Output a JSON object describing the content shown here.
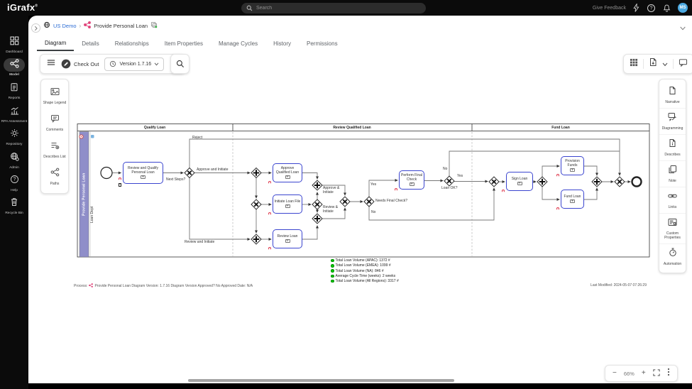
{
  "topbar": {
    "logo": "iGrafx",
    "logo_mark": "®",
    "search_placeholder": "Search",
    "give_feedback": "Give Feedback",
    "avatar": "MS"
  },
  "sidebar": {
    "items": [
      {
        "label": "Dashboard"
      },
      {
        "label": "Model"
      },
      {
        "label": "Reports"
      },
      {
        "label": "RPA Assessment"
      },
      {
        "label": "Repository"
      },
      {
        "label": "Admin"
      },
      {
        "label": "Help"
      },
      {
        "label": "Recycle Bin"
      }
    ]
  },
  "breadcrumb": {
    "root": "US Demo",
    "sep": "›",
    "current": "Provide Personal Loan"
  },
  "tabs": [
    {
      "label": "Diagram"
    },
    {
      "label": "Details"
    },
    {
      "label": "Relationships"
    },
    {
      "label": "Item Properties"
    },
    {
      "label": "Manage Cycles"
    },
    {
      "label": "History"
    },
    {
      "label": "Permissions"
    }
  ],
  "toolbar": {
    "checkout_label": "Check Out",
    "version_label": "Version 1.7.16"
  },
  "left_panel": {
    "items": [
      {
        "label": "Shape Legend"
      },
      {
        "label": "Comments"
      },
      {
        "label": "Describes List"
      },
      {
        "label": "Paths"
      }
    ]
  },
  "right_panel": {
    "items": [
      {
        "label": "Narrative"
      },
      {
        "label": "Diagramming"
      },
      {
        "label": "Describes"
      },
      {
        "label": "Note"
      },
      {
        "label": "Links"
      },
      {
        "label": "Custom Properties"
      },
      {
        "label": "Automation"
      }
    ]
  },
  "diagram": {
    "phases": [
      {
        "label": "Qualify Loan"
      },
      {
        "label": "Review Qualified Loan"
      },
      {
        "label": "Fund Loan"
      }
    ],
    "lane": "Provide Personal Loan",
    "department": "Loan Dept",
    "tasks": {
      "review_qualify": "Review and Qualify Personal Loan",
      "approve_qualified": "Approve Qualified Loan",
      "initiate_file": "Initiate Loan File",
      "review_loan": "Review Loan",
      "final_check": "Perform Final Check",
      "sign_loan": "Sign Loan",
      "provision_funds": "Provision Funds",
      "fund_loan": "Fund Loan"
    },
    "labels": {
      "reject": "Reject",
      "approve_and_initiate": "Approve and Initiate",
      "next_steps": "Next Steps?",
      "review_and_initiate": "Review and Initiate",
      "approve_initiate2": "Approve & Initiate",
      "review_initiate2": "Review & Initiate",
      "needs_final_check": "Needs Final Check?",
      "loan_ok": "Loan OK?",
      "yes1": "Yes",
      "no1": "No",
      "yes2": "Yes",
      "no2": "No"
    }
  },
  "stats": [
    "Total Loan Volume (APAC): 1372 #",
    "Total Loan Volume (EMEA): 1099 #",
    "Total Loan Volume (NA): 846 #",
    "Average Cycle Time (weeks): 2 weeks",
    "Total Loan Volume (All Regions): 3317 #"
  ],
  "footer": {
    "process_prefix": "Process:",
    "process_info": "Provide Personal Loan  Diagram Version: 1.7.16  Diagram Version Approved? No  Approved Date: N/A",
    "last_modified": "Last Modified: 2024-05-07 07:26:29"
  },
  "zoom_controls": {
    "level": "66%"
  },
  "icons": {
    "plus": "+",
    "minus": "−",
    "question": "?"
  },
  "colors": {
    "task_border": "#3b45cf",
    "lane_purple": "#8f8ec9",
    "stat_green": "#00c800",
    "link_blue": "#2b6cd4",
    "share_pink": "#e0457b",
    "avatar_blue": "#4aa8e0"
  }
}
